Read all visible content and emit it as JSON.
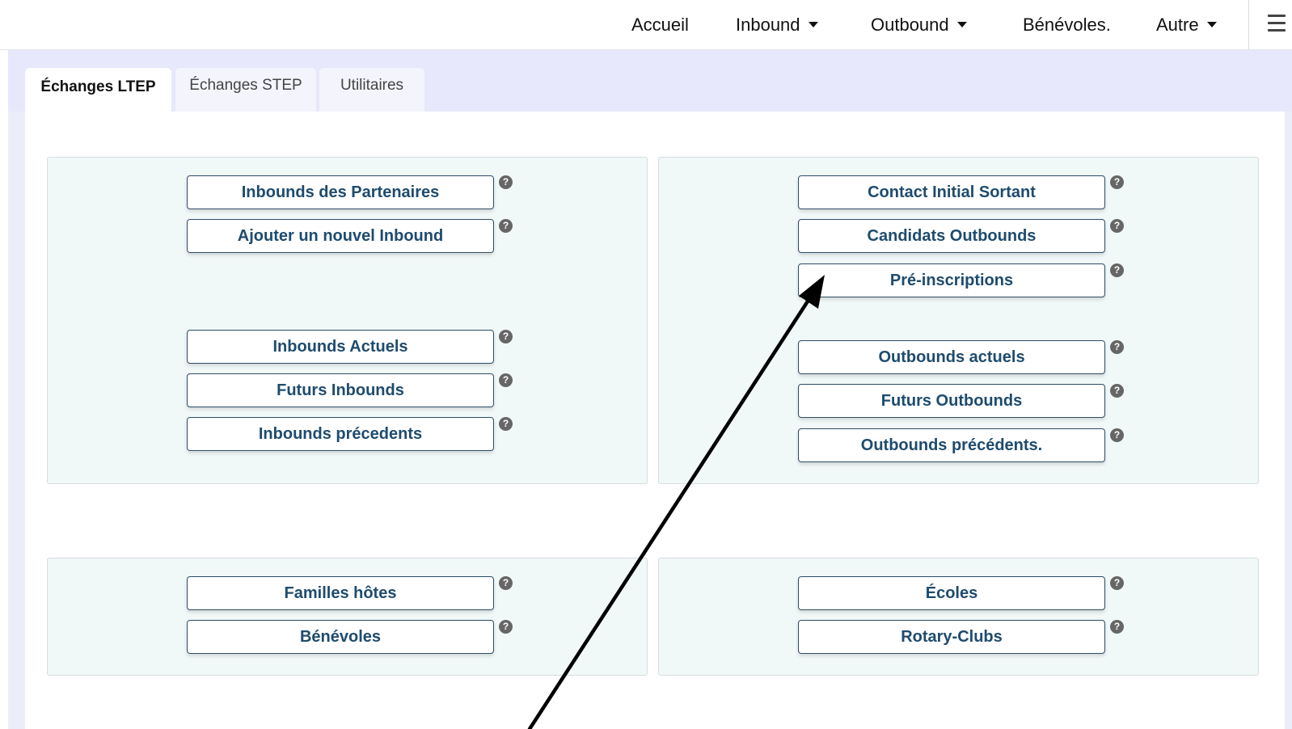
{
  "nav": {
    "items": [
      {
        "label": "Accueil",
        "dropdown": false
      },
      {
        "label": "Inbound",
        "dropdown": true
      },
      {
        "label": "Outbound",
        "dropdown": true
      },
      {
        "label": "Bénévoles.",
        "dropdown": false
      },
      {
        "label": "Autre",
        "dropdown": true
      }
    ],
    "menu_icon": "hamburger-icon"
  },
  "tabs": [
    {
      "label": "Échanges LTEP",
      "active": true
    },
    {
      "label": "Échanges STEP",
      "active": false
    },
    {
      "label": "Utilitaires",
      "active": false
    }
  ],
  "panels": {
    "inbound": {
      "group1": [
        "Inbounds des Partenaires",
        "Ajouter un nouvel Inbound"
      ],
      "group2": [
        "Inbounds Actuels",
        "Futurs Inbounds",
        "Inbounds précedents"
      ]
    },
    "outbound": {
      "group1": [
        "Contact Initial Sortant",
        "Candidats Outbounds",
        "Pré-inscriptions"
      ],
      "group2": [
        "Outbounds actuels",
        "Futurs Outbounds",
        "Outbounds précédents."
      ]
    },
    "hosts": [
      "Familles hôtes",
      "Bénévoles"
    ],
    "clubs": [
      "Écoles",
      "Rotary-Clubs"
    ]
  },
  "help_glyph": "?",
  "colors": {
    "button_text": "#1e4b6e",
    "button_border": "#2d4d66",
    "panel_bg": "#f1f8f8",
    "strip_bg": "#ebeef9",
    "annotation_arrow": "#000000"
  },
  "annotation": {
    "icon": "arrow-pointer",
    "target": "Pré-inscriptions"
  }
}
